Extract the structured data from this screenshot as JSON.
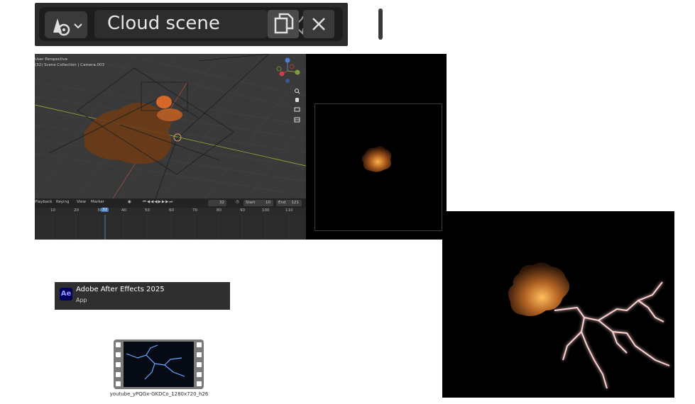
{
  "header": {
    "scene_name": "Cloud scene",
    "scene_icon": "scene-data-icon",
    "dropdown_icon": "chevron-down-icon",
    "pin_icon": "pin-icon",
    "copy_icon": "duplicate-icon",
    "close_icon": "close-icon"
  },
  "viewport": {
    "info_line1": "User Perspective",
    "info_line2": "(32) Scene Collection | Camera.003",
    "nav_icons": [
      "zoom-icon",
      "pan-hand-icon",
      "camera-view-icon",
      "grid-view-icon"
    ]
  },
  "timeline": {
    "menu": [
      "Playback",
      "Keying",
      "View",
      "Marker"
    ],
    "current_frame": "32",
    "start_label": "Start",
    "start_value": "10",
    "end_label": "End",
    "end_value": "121",
    "ruler_numbers": [
      "10",
      "20",
      "30",
      "32",
      "40",
      "50",
      "60",
      "70",
      "80",
      "90",
      "100",
      "110"
    ]
  },
  "search_result": {
    "app_icon_text": "Ae",
    "app_name": "Adobe After Effects 2025",
    "app_type": "App"
  },
  "file": {
    "filename": "youtube_yPQGx-GKDCo_1280x720_h26"
  },
  "colors": {
    "accent_blue": "#4a7fc9",
    "cloud_orange": "#c46a1e",
    "lightning_pink": "#f0a0a0"
  }
}
